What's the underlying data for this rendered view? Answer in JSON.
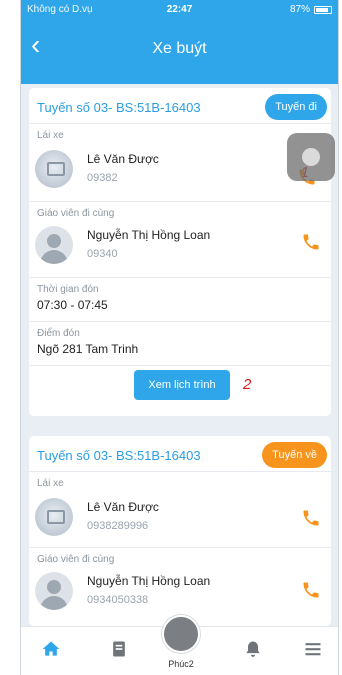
{
  "status_bar": {
    "carrier": "Không có D.vụ",
    "time": "22:47",
    "battery": "87%"
  },
  "header": {
    "title": "Xe buýt"
  },
  "trips": [
    {
      "route": "Tuyến số 03- BS:51B-16403",
      "direction": "Tuyến đi",
      "driver_label": "Lái xe",
      "driver_name": "Lê Văn Được",
      "driver_phone": "09382",
      "teacher_label": "Giáo viên đi cùng",
      "teacher_name": "Nguyễn Thị Hồng Loan",
      "teacher_phone": "09340",
      "pickup_time_label": "Thời gian đón",
      "pickup_time": "07:30 - 07:45",
      "pickup_place_label": "Điểm đón",
      "pickup_place": "Ngõ 281 Tam Trinh",
      "schedule_button": "Xem lịch trình"
    },
    {
      "route": "Tuyến số 03- BS:51B-16403",
      "direction": "Tuyến về",
      "driver_label": "Lái xe",
      "driver_name": "Lê Văn Được",
      "driver_phone": "0938289996",
      "teacher_label": "Giáo viên đi cùng",
      "teacher_name": "Nguyễn Thị Hồng Loan",
      "teacher_phone": "0934050338"
    }
  ],
  "annotations": {
    "call": "1",
    "schedule": "2"
  },
  "bottom_nav": {
    "items": [
      "home-icon",
      "book-icon",
      "bell-icon",
      "menu-icon"
    ],
    "center_label": "Phúc2"
  },
  "colors": {
    "primary": "#2ea6e9",
    "accent": "#f7941d",
    "annotation": "#e21b1b"
  }
}
